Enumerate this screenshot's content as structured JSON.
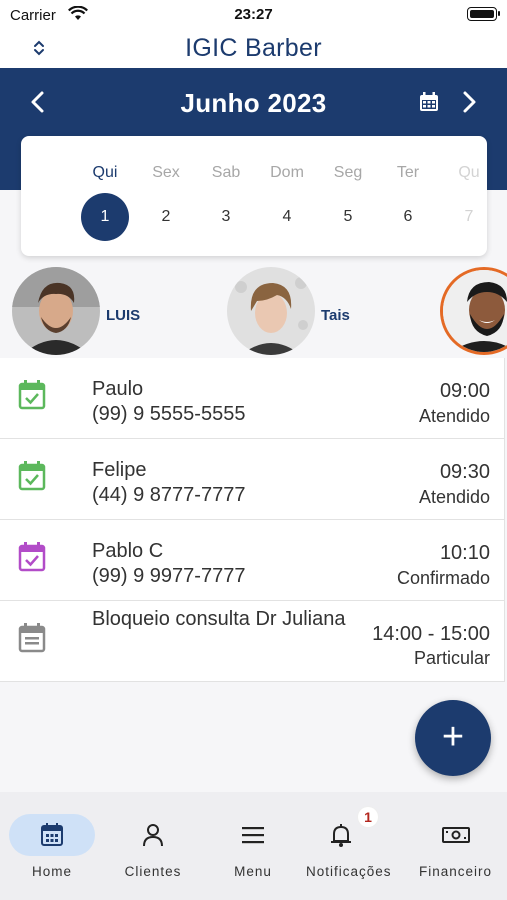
{
  "status_bar": {
    "carrier": "Carrier",
    "time": "23:27"
  },
  "header": {
    "title": "IGIC Barber"
  },
  "calendar": {
    "month": "Junho 2023",
    "days": [
      {
        "name": "Qui",
        "num": "1",
        "state": "selected"
      },
      {
        "name": "Sex",
        "num": "2",
        "state": "normal"
      },
      {
        "name": "Sab",
        "num": "3",
        "state": "normal"
      },
      {
        "name": "Dom",
        "num": "4",
        "state": "normal"
      },
      {
        "name": "Seg",
        "num": "5",
        "state": "normal"
      },
      {
        "name": "Ter",
        "num": "6",
        "state": "normal"
      },
      {
        "name": "Qu",
        "num": "7",
        "state": "faded"
      }
    ]
  },
  "professionals": [
    {
      "name": "LUIS"
    },
    {
      "name": "Tais"
    },
    {
      "name": ""
    }
  ],
  "appointments": [
    {
      "client": "Paulo",
      "phone": "(99) 9 5555-5555",
      "time": "09:00",
      "status": "Atendido",
      "color": "#5cb85c"
    },
    {
      "client": "Felipe",
      "phone": "(44) 9 8777-7777",
      "time": "09:30",
      "status": "Atendido",
      "color": "#5cb85c"
    },
    {
      "client": "Pablo C",
      "phone": "(99) 9 9977-7777",
      "time": "10:10",
      "status": "Confirmado",
      "color": "#b24cc8"
    },
    {
      "client": "Bloqueio consulta Dr Juliana",
      "phone": "",
      "time": "14:00 - 15:00",
      "status": "Particular",
      "color": "#8a8a8a"
    }
  ],
  "fab": {
    "label": "+"
  },
  "nav": {
    "items": [
      {
        "label": "Home",
        "icon": "calendar-icon"
      },
      {
        "label": "Clientes",
        "icon": "person-icon"
      },
      {
        "label": "Menu",
        "icon": "menu-icon"
      },
      {
        "label": "Notificações",
        "icon": "bell-icon",
        "badge": "1"
      },
      {
        "label": "Financeiro",
        "icon": "money-icon"
      }
    ]
  },
  "colors": {
    "primary": "#1c3b6e",
    "nav_active": "#cfe1f7",
    "badge": "#b3261e"
  }
}
